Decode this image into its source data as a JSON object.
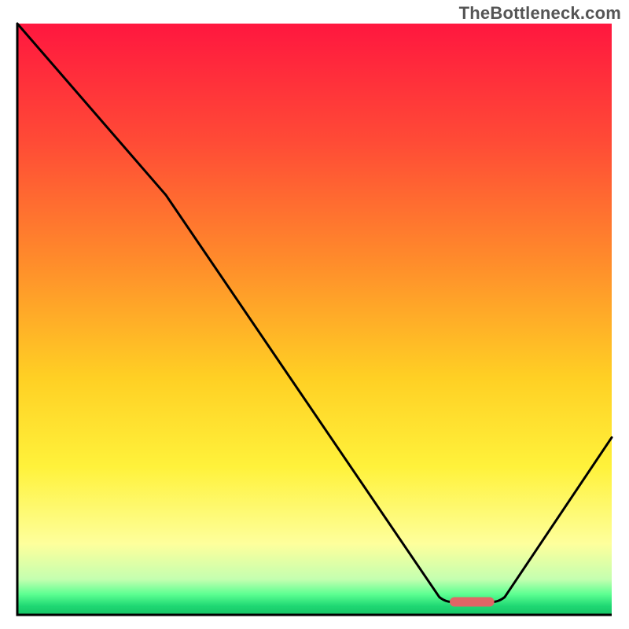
{
  "watermark": "TheBottleneck.com",
  "chart_data": {
    "type": "line",
    "title": "",
    "xlabel": "",
    "ylabel": "",
    "xlim": [
      0,
      100
    ],
    "ylim": [
      0,
      100
    ],
    "background_gradient": {
      "stops": [
        {
          "offset": 0.0,
          "color": "#ff173f"
        },
        {
          "offset": 0.2,
          "color": "#ff4b36"
        },
        {
          "offset": 0.4,
          "color": "#ff8b2b"
        },
        {
          "offset": 0.6,
          "color": "#ffd024"
        },
        {
          "offset": 0.75,
          "color": "#fff23b"
        },
        {
          "offset": 0.88,
          "color": "#feff9c"
        },
        {
          "offset": 0.94,
          "color": "#c4ffb0"
        },
        {
          "offset": 0.965,
          "color": "#5dff92"
        },
        {
          "offset": 0.985,
          "color": "#1fd873"
        },
        {
          "offset": 1.0,
          "color": "#16c466"
        }
      ]
    },
    "curve": {
      "note": "Y is bottleneck-style deviation (0 = optimal at valley floor). X normalized 0-100.",
      "points": [
        {
          "x": 0.0,
          "y": 100.0
        },
        {
          "x": 25.0,
          "y": 71.0
        },
        {
          "x": 71.0,
          "y": 3.0
        },
        {
          "x": 73.0,
          "y": 2.2
        },
        {
          "x": 80.0,
          "y": 2.2
        },
        {
          "x": 82.0,
          "y": 3.0
        },
        {
          "x": 100.0,
          "y": 30.0
        }
      ]
    },
    "optimal_marker": {
      "center_x": 76.5,
      "y": 2.2,
      "width": 7.5,
      "color": "#e06666"
    }
  }
}
